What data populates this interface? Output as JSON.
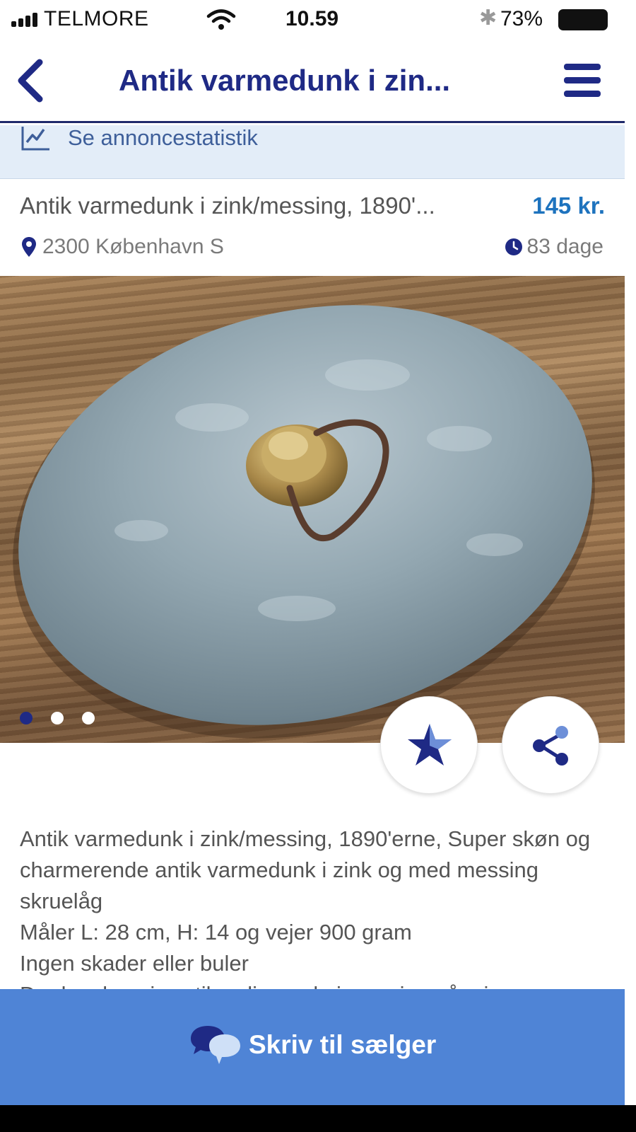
{
  "status_bar": {
    "carrier": "TELMORE",
    "time": "10.59",
    "battery": "73%"
  },
  "nav": {
    "title": "Antik varmedunk i zin...",
    "back_icon": "chevron-left-icon",
    "menu_icon": "hamburger-menu-icon"
  },
  "stats_banner": {
    "label": "Se annoncestatistik",
    "icon": "line-chart-icon"
  },
  "listing": {
    "title": "Antik varmedunk i zink/messing, 1890'...",
    "price": "145 kr.",
    "location": "2300 København S",
    "age": "83 dage"
  },
  "photo": {
    "count": 3,
    "active_index": 0
  },
  "actions": {
    "favorite_icon": "star-icon",
    "share_icon": "share-icon"
  },
  "description": {
    "lines": [
      "Antik varmedunk i zink/messing, 1890'erne, Super skøn og charmerende antik varmedunk i zink og med messing skruelåg",
      "Måler L: 28 cm, H: 14 og vejer 900 gram",
      "Ingen skader eller buler",
      "Der kan henvises til en lignende i messing på mine"
    ]
  },
  "cta": {
    "label": "Skriv til sælger",
    "icon": "chat-bubbles-icon"
  },
  "colors": {
    "brand_blue": "#1f2a85",
    "price_blue": "#1e73be",
    "cta_blue": "#4f84d6",
    "banner_bg": "#e3edf8"
  }
}
